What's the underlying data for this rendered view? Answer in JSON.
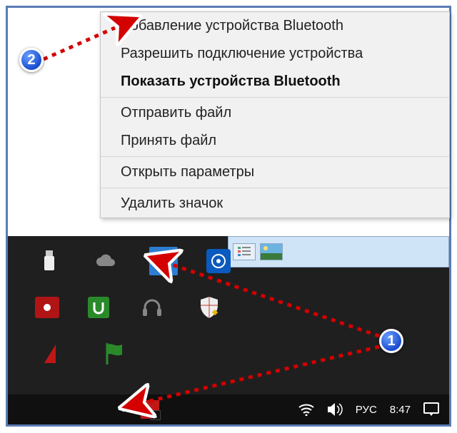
{
  "menu": {
    "items": [
      {
        "label": "Добавление устройства Bluetooth",
        "bold": false
      },
      {
        "label": "Разрешить подключение устройства",
        "bold": false
      },
      {
        "label": "Показать устройства Bluetooth",
        "bold": true
      }
    ],
    "items2": [
      {
        "label": "Отправить файл"
      },
      {
        "label": "Принять файл"
      }
    ],
    "items3": [
      {
        "label": "Открыть параметры"
      }
    ],
    "items4": [
      {
        "label": "Удалить значок"
      }
    ]
  },
  "tray": {
    "lang": "РУС",
    "time": "8:47"
  },
  "badges": {
    "one": "1",
    "two": "2"
  },
  "icons": {
    "usb": "usb-icon",
    "cloud": "cloud-icon",
    "bluetooth": "bluetooth-icon",
    "intel": "intel-icon",
    "camera": "camera-icon",
    "utorrent": "utorrent-icon",
    "headset": "headset-icon",
    "shield": "shield-icon",
    "triangle": "triangle-icon",
    "flag": "flag-icon",
    "wifi": "wifi-icon",
    "volume": "volume-icon",
    "notification": "notification-icon",
    "chevron": "chevron-up-icon"
  }
}
